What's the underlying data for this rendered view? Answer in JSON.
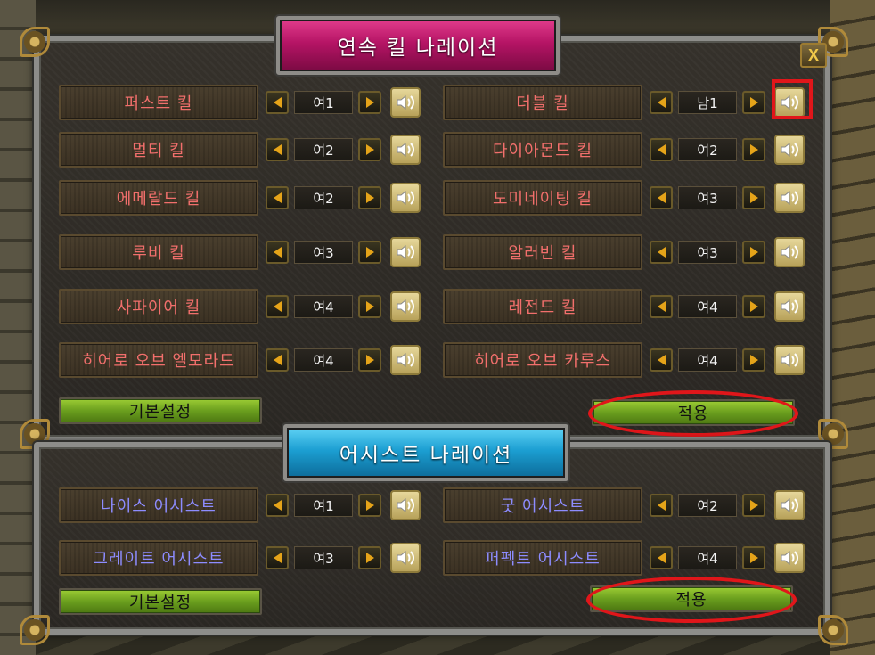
{
  "kill_panel": {
    "title": "연속 킬 나레이션",
    "close_label": "X",
    "rows": [
      {
        "left": {
          "name": "퍼스트 킬",
          "voice": "여1"
        },
        "right": {
          "name": "더블 킬",
          "voice": "남1"
        }
      },
      {
        "left": {
          "name": "멀티 킬",
          "voice": "여2"
        },
        "right": {
          "name": "다이아몬드 킬",
          "voice": "여2"
        }
      },
      {
        "left": {
          "name": "에메랄드 킬",
          "voice": "여2"
        },
        "right": {
          "name": "도미네이팅 킬",
          "voice": "여3"
        }
      },
      {
        "left": {
          "name": "루비 킬",
          "voice": "여3"
        },
        "right": {
          "name": "알러빈 킬",
          "voice": "여3"
        }
      },
      {
        "left": {
          "name": "사파이어 킬",
          "voice": "여4"
        },
        "right": {
          "name": "레전드 킬",
          "voice": "여4"
        }
      },
      {
        "left": {
          "name": "히어로 오브 엘모라드",
          "voice": "여4"
        },
        "right": {
          "name": "히어로 오브 카루스",
          "voice": "여4"
        }
      }
    ],
    "default_label": "기본설정",
    "apply_label": "적용"
  },
  "assist_panel": {
    "title": "어시스트 나레이션",
    "rows": [
      {
        "left": {
          "name": "나이스 어시스트",
          "voice": "여1"
        },
        "right": {
          "name": "굿 어시스트",
          "voice": "여2"
        }
      },
      {
        "left": {
          "name": "그레이트 어시스트",
          "voice": "여3"
        },
        "right": {
          "name": "퍼펙트 어시스트",
          "voice": "여4"
        }
      }
    ],
    "default_label": "기본설정",
    "apply_label": "적용"
  },
  "icons": {
    "prev": "arrow-left-icon",
    "next": "arrow-right-icon",
    "speaker": "speaker-icon",
    "close": "close-icon"
  },
  "colors": {
    "kill_name": "#f26f6c",
    "assist_name": "#8d8cff",
    "arrow": "#e5a419",
    "highlight": "#e0161a"
  }
}
